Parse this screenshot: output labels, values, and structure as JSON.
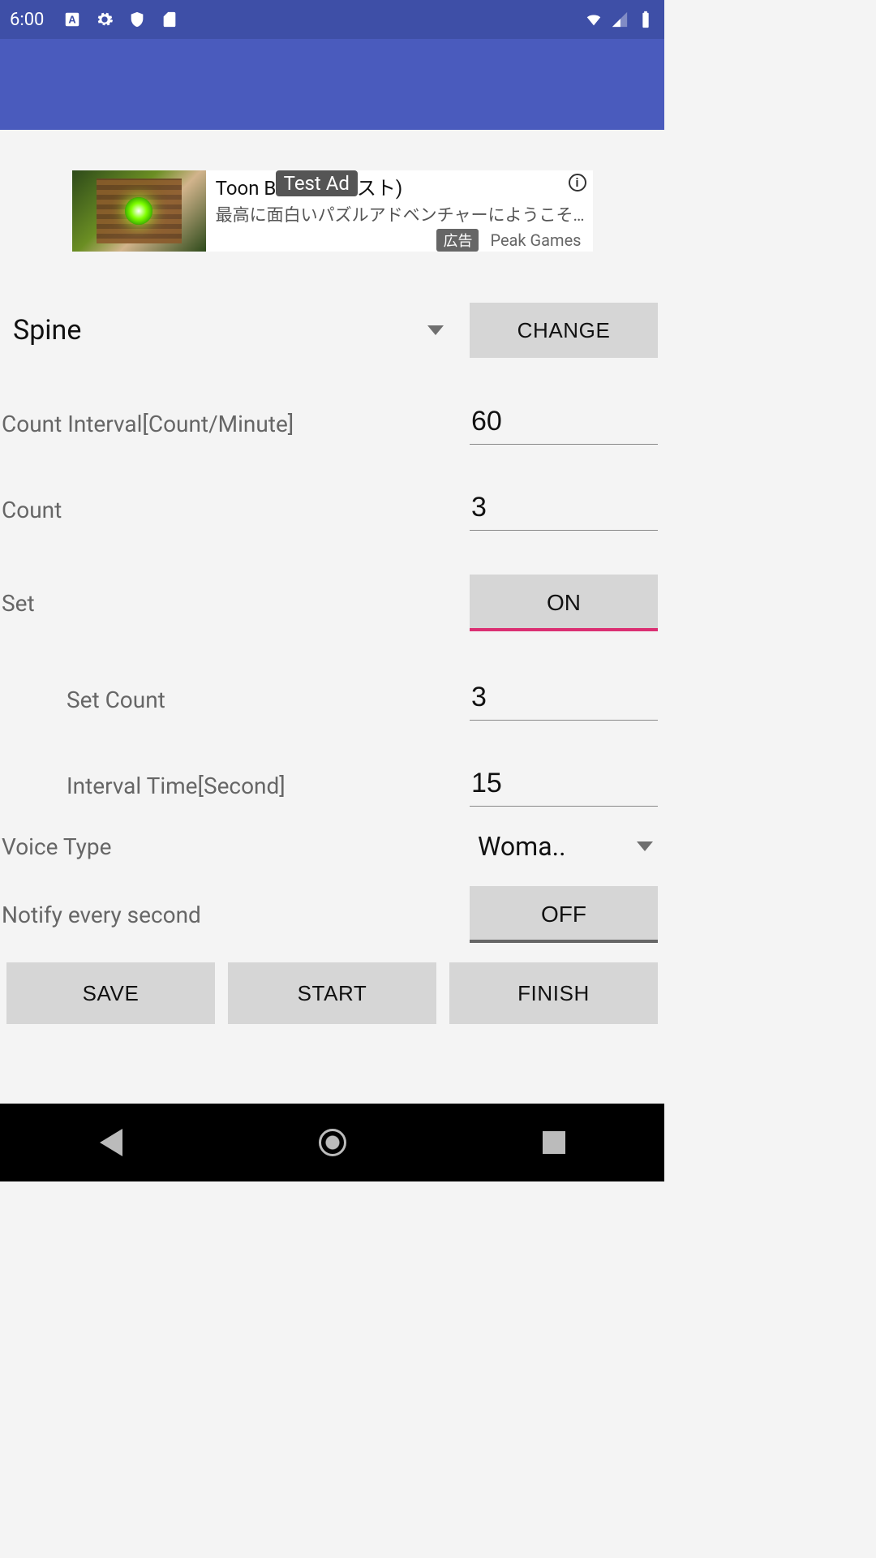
{
  "status": {
    "time": "6:00"
  },
  "ad": {
    "title": "Toon B      ーンブラスト)",
    "test_label": "Test Ad",
    "subtitle": "最高に面白いパズルアドベンチャーにようこそ…",
    "badge": "広告",
    "advertiser": "Peak Games"
  },
  "form": {
    "exercise_selected": "Spine",
    "change_label": "CHANGE",
    "count_interval_label": "Count Interval[Count/Minute]",
    "count_interval_value": "60",
    "count_label": "Count",
    "count_value": "3",
    "set_label": "Set",
    "set_toggle": "ON",
    "set_count_label": "Set Count",
    "set_count_value": "3",
    "interval_time_label": "Interval Time[Second]",
    "interval_time_value": "15",
    "voice_type_label": "Voice Type",
    "voice_type_selected": "Woma..",
    "notify_label": "Notify every second",
    "notify_toggle": "OFF"
  },
  "buttons": {
    "save": "SAVE",
    "start": "START",
    "finish": "FINISH"
  }
}
